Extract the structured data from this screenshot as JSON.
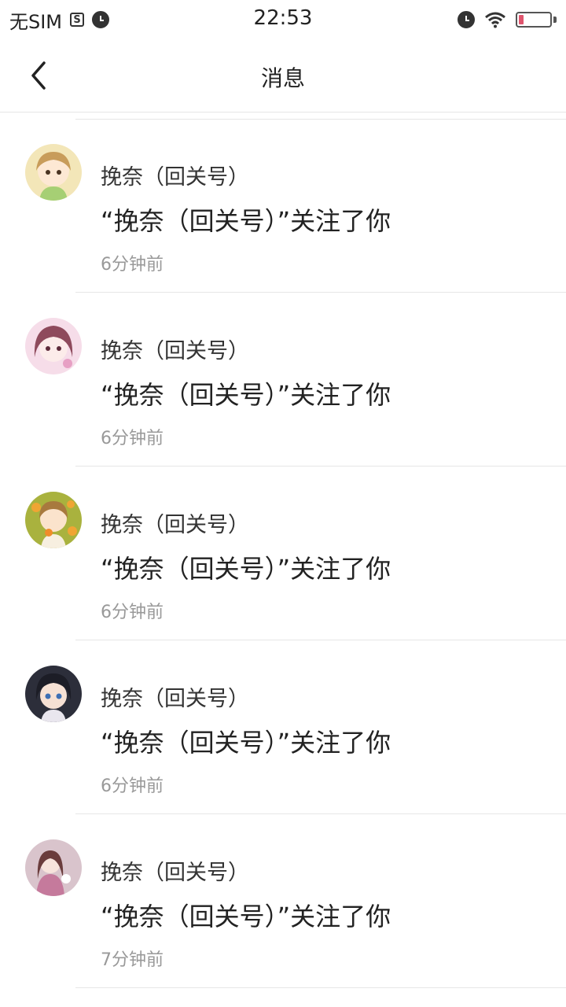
{
  "status_bar": {
    "carrier": "无SIM",
    "sim_icon_letter": "S",
    "time": "22:53",
    "battery_level": 0.15,
    "icons": [
      "sim-s-icon",
      "alarm-icon",
      "alarm-icon",
      "wifi-icon",
      "battery-icon"
    ]
  },
  "nav": {
    "back_icon": "chevron-left-icon",
    "title": "消息"
  },
  "colors": {
    "battery_low": "#e0556e",
    "time_text": "#999999",
    "divider": "#e6e6e6"
  },
  "messages": [
    {
      "name": "挽奈（回关号）",
      "text": "“挽奈（回关号）”关注了你",
      "time": "6分钟前"
    },
    {
      "name": "挽奈（回关号）",
      "text": "“挽奈（回关号）”关注了你",
      "time": "6分钟前"
    },
    {
      "name": "挽奈（回关号）",
      "text": "“挽奈（回关号）”关注了你",
      "time": "6分钟前"
    },
    {
      "name": "挽奈（回关号）",
      "text": "“挽奈（回关号）”关注了你",
      "time": "6分钟前"
    },
    {
      "name": "挽奈（回关号）",
      "text": "“挽奈（回关号）”关注了你",
      "time": "7分钟前"
    }
  ]
}
